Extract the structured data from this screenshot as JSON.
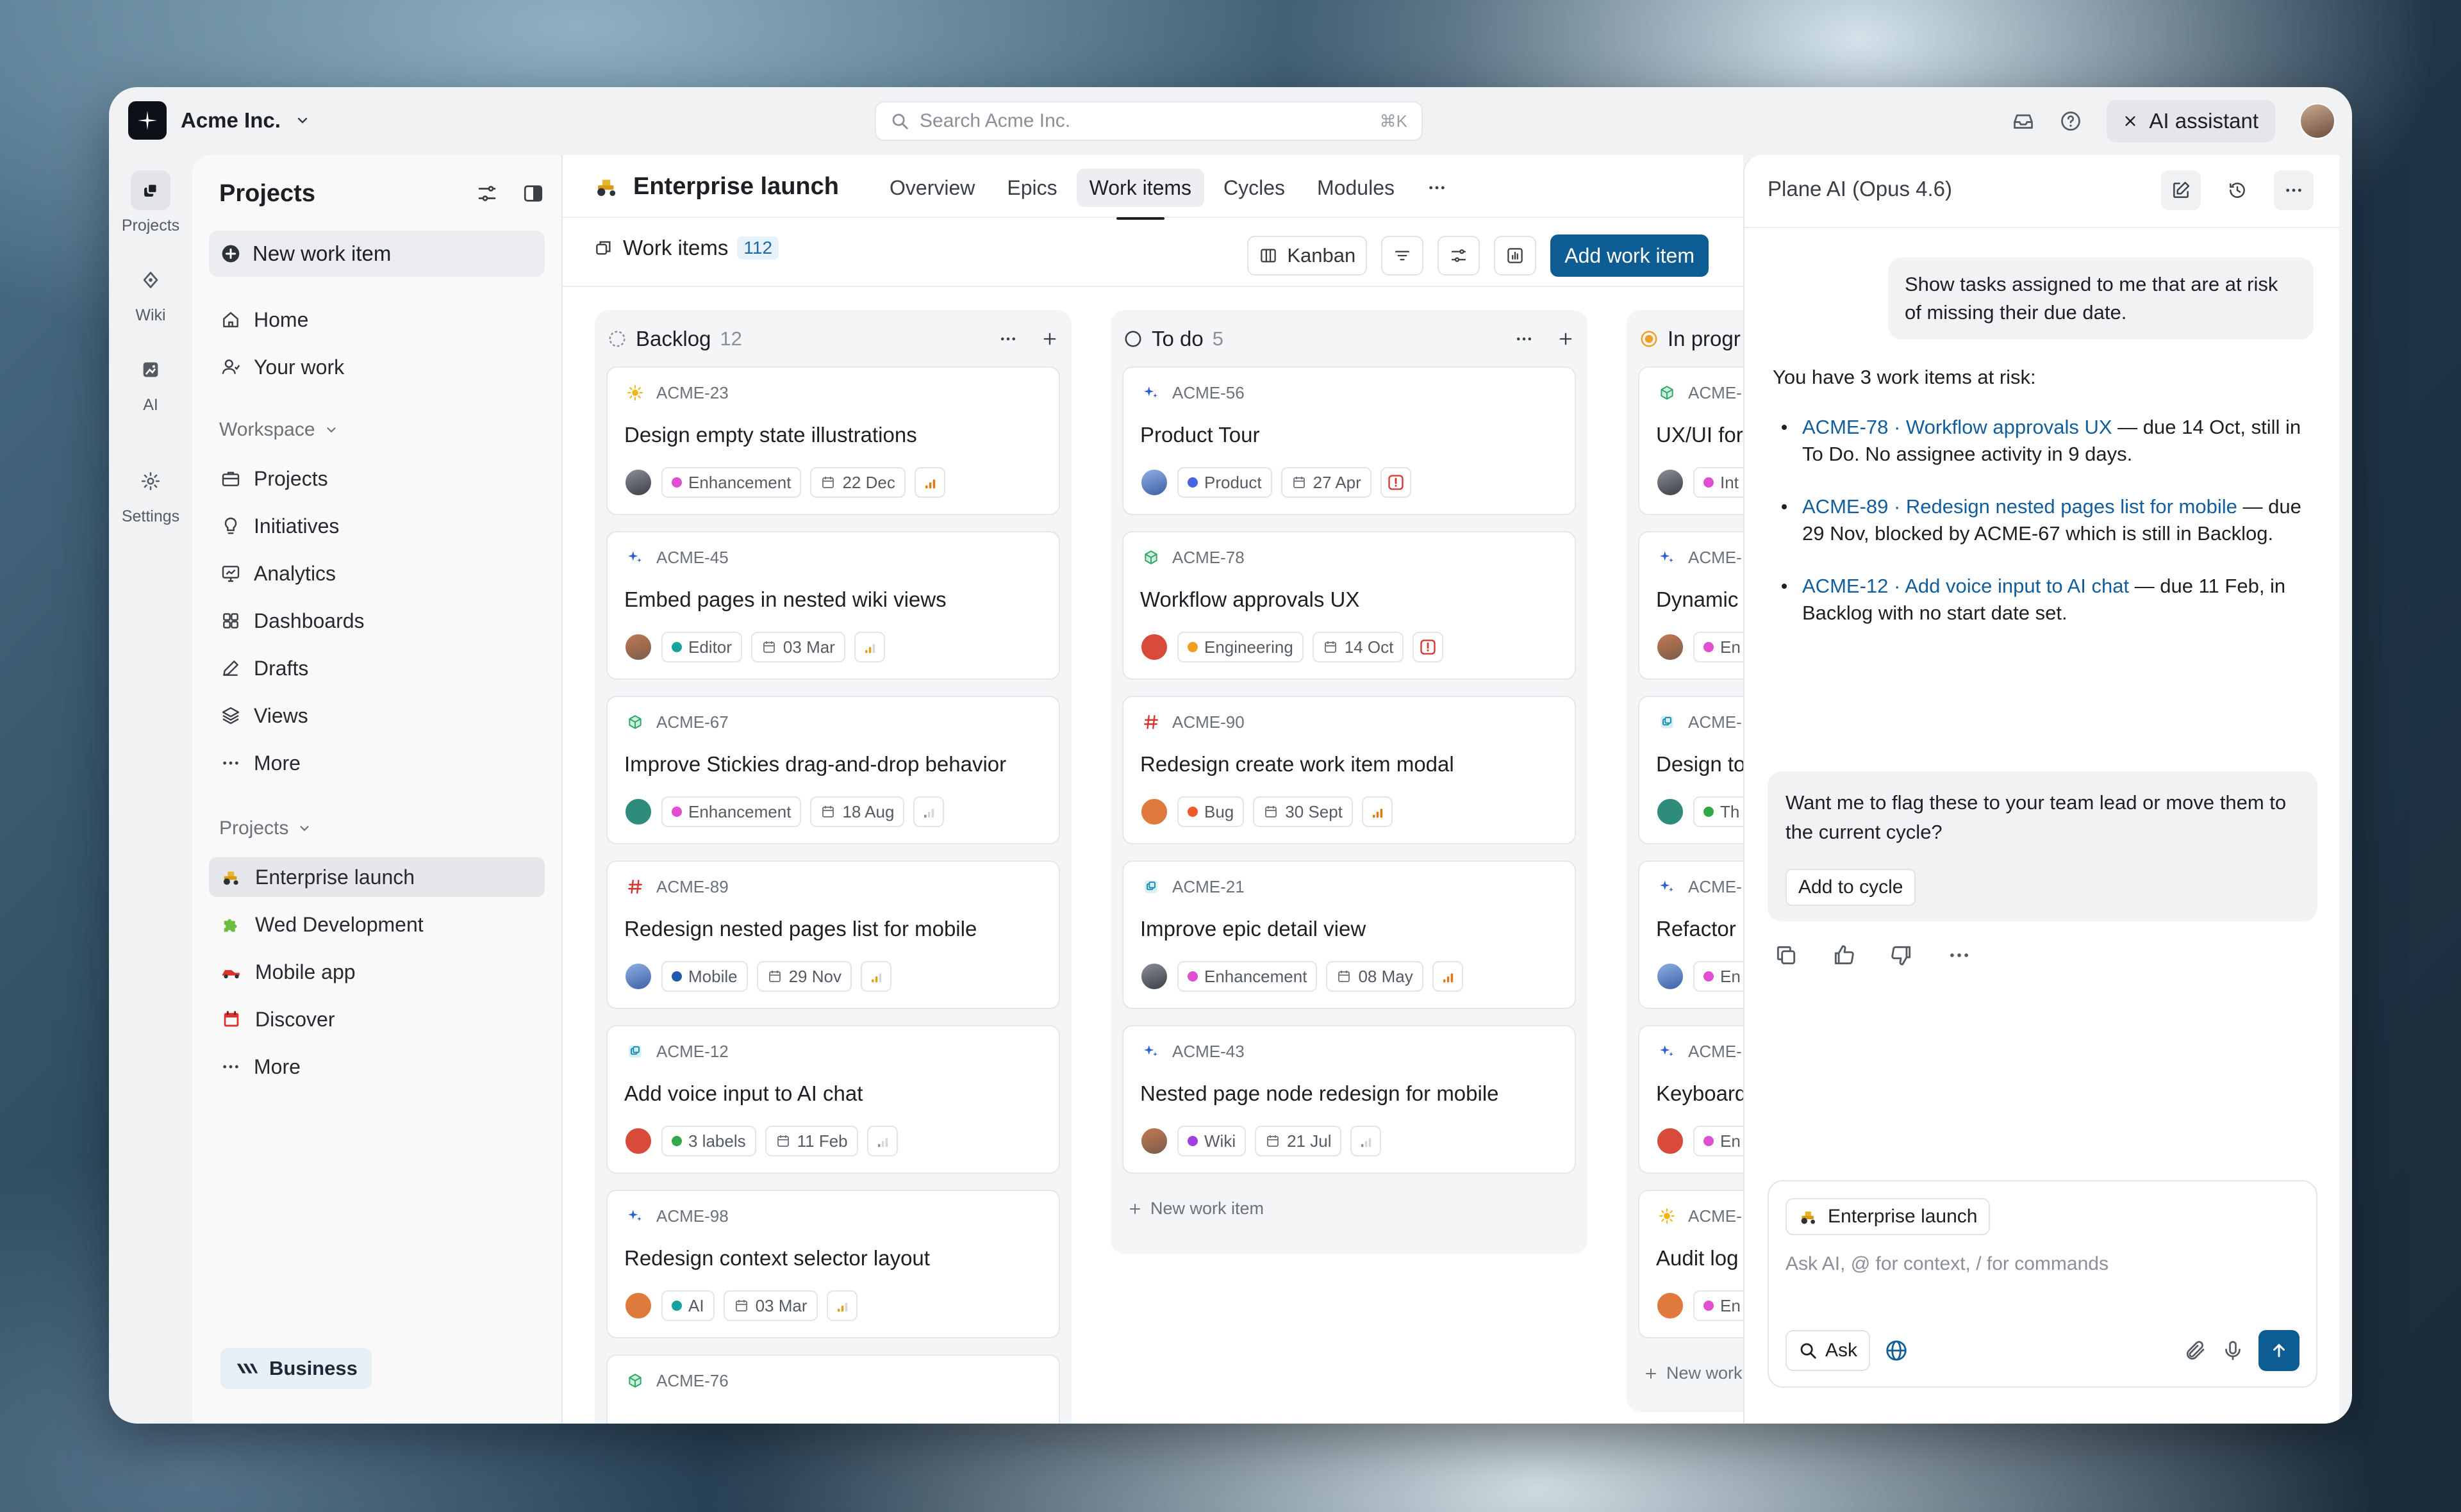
{
  "org": {
    "name": "Acme Inc."
  },
  "search": {
    "placeholder": "Search Acme Inc.",
    "shortcut": "⌘K"
  },
  "topbar": {
    "ai_assistant_label": "AI assistant"
  },
  "rail": [
    {
      "label": "Projects",
      "icon": "projects-icon"
    },
    {
      "label": "Wiki",
      "icon": "wiki-icon"
    },
    {
      "label": "AI",
      "icon": "ai-icon"
    },
    {
      "label": "Settings",
      "icon": "gear-icon"
    }
  ],
  "sidebar": {
    "title": "Projects",
    "new_work_item": "New work item",
    "nav": [
      "Home",
      "Your work"
    ],
    "workspace_label": "Workspace",
    "workspace_items": [
      "Projects",
      "Initiatives",
      "Analytics",
      "Dashboards",
      "Drafts",
      "Views",
      "More"
    ],
    "projects_label": "Projects",
    "projects": [
      "Enterprise launch",
      "Wed Development",
      "Mobile app",
      "Discover",
      "More"
    ],
    "plan_badge": "Business"
  },
  "main": {
    "project_title": "Enterprise launch",
    "tabs": [
      "Overview",
      "Epics",
      "Work items",
      "Cycles",
      "Modules"
    ],
    "active_tab": "Work items",
    "work_items_label": "Work items",
    "work_items_count": "112",
    "layout_label": "Kanban",
    "add_work_item": "Add work item",
    "new_work_item_row": "New work item"
  },
  "columns": [
    {
      "name": "Backlog",
      "count": "12",
      "cards": [
        {
          "id": "ACME-23",
          "title": "Design empty state illustrations",
          "type": "sun",
          "label": "Enhancement",
          "label_color": "#e04fd0",
          "date": "22 Dec",
          "prio": "high"
        },
        {
          "id": "ACME-45",
          "title": "Embed pages in nested wiki views",
          "type": "spark",
          "label": "Editor",
          "label_color": "#14a3a3",
          "date": "03 Mar",
          "prio": "medium"
        },
        {
          "id": "ACME-67",
          "title": "Improve Stickies drag-and-drop behavior",
          "type": "cube",
          "label": "Enhancement",
          "label_color": "#e04fd0",
          "date": "18 Aug",
          "prio": "low"
        },
        {
          "id": "ACME-89",
          "title": "Redesign nested pages list for mobile",
          "type": "hash",
          "label": "Mobile",
          "label_color": "#1e5aa8",
          "date": "29 Nov",
          "prio": "medium"
        },
        {
          "id": "ACME-12",
          "title": "Add voice input to AI chat",
          "type": "layers",
          "label": "3 labels",
          "label_color": "#2faa4a",
          "date": "11 Feb",
          "prio": "low"
        },
        {
          "id": "ACME-98",
          "title": "Redesign context selector layout",
          "type": "spark",
          "label": "AI",
          "label_color": "#14a3a3",
          "date": "03 Mar",
          "prio": "medium"
        },
        {
          "id": "ACME-76",
          "title": "",
          "type": "cube",
          "label": "",
          "label_color": "#e04fd0",
          "date": "",
          "prio": "low"
        }
      ]
    },
    {
      "name": "To do",
      "count": "5",
      "cards": [
        {
          "id": "ACME-56",
          "title": "Product Tour",
          "type": "spark",
          "label": "Product",
          "label_color": "#4a63e0",
          "date": "27 Apr",
          "prio": "urgent"
        },
        {
          "id": "ACME-78",
          "title": "Workflow approvals UX",
          "type": "cube",
          "label": "Engineering",
          "label_color": "#f0a020",
          "date": "14 Oct",
          "prio": "urgent"
        },
        {
          "id": "ACME-90",
          "title": "Redesign create work item modal",
          "type": "hash",
          "label": "Bug",
          "label_color": "#f05a28",
          "date": "30 Sept",
          "prio": "high"
        },
        {
          "id": "ACME-21",
          "title": "Improve epic detail view",
          "type": "layers",
          "label": "Enhancement",
          "label_color": "#e04fd0",
          "date": "08 May",
          "prio": "high"
        },
        {
          "id": "ACME-43",
          "title": "Nested page node redesign for mobile",
          "type": "spark",
          "label": "Wiki",
          "label_color": "#a040e0",
          "date": "21 Jul",
          "prio": "low"
        }
      ]
    },
    {
      "name": "In progr",
      "count": "",
      "cards": [
        {
          "id": "ACME-",
          "title": "UX/UI for",
          "type": "cube",
          "label": "Int",
          "label_color": "#e04fd0",
          "date": "",
          "prio": ""
        },
        {
          "id": "ACME-",
          "title": "Dynamic",
          "type": "spark",
          "label": "En",
          "label_color": "#e04fd0",
          "date": "",
          "prio": ""
        },
        {
          "id": "ACME-",
          "title": "Design to",
          "type": "layers",
          "label": "Th",
          "label_color": "#2faa4a",
          "date": "",
          "prio": ""
        },
        {
          "id": "ACME-",
          "title": "Refactor",
          "type": "spark",
          "label": "En",
          "label_color": "#e04fd0",
          "date": "",
          "prio": ""
        },
        {
          "id": "ACME-",
          "title": "Keyboard",
          "type": "spark",
          "label": "En",
          "label_color": "#e04fd0",
          "date": "",
          "prio": ""
        },
        {
          "id": "ACME-",
          "title": "Audit log",
          "type": "sun",
          "label": "En",
          "label_color": "#e04fd0",
          "date": "",
          "prio": ""
        }
      ],
      "new_work_item": "New work"
    }
  ],
  "ai": {
    "title": "Plane AI (Opus 4.6)",
    "user_message": "Show tasks assigned to me that are at risk of missing their due date.",
    "intro": "You have 3 work items at risk:",
    "items": [
      {
        "link": "ACME-78 · Workflow approvals UX",
        "rest": " — due 14 Oct, still in To Do. No assignee activity in 9 days."
      },
      {
        "link": "ACME-89 · Redesign nested pages list for mobile",
        "rest": " — due 29 Nov, blocked by ACME-67 which is still in Backlog."
      },
      {
        "link": "ACME-12 · Add voice input to AI chat",
        "rest": " — due 11 Feb, in Backlog with no start date set."
      }
    ],
    "question": "Want me to flag these to your team lead or move them to the current cycle?",
    "action_button": "Add to cycle",
    "context_chip": "Enterprise launch",
    "input_placeholder": "Ask AI, @ for context, / for commands",
    "ask_label": "Ask"
  },
  "colors": {
    "primary": "#0d5c94",
    "link": "#125e9c"
  }
}
